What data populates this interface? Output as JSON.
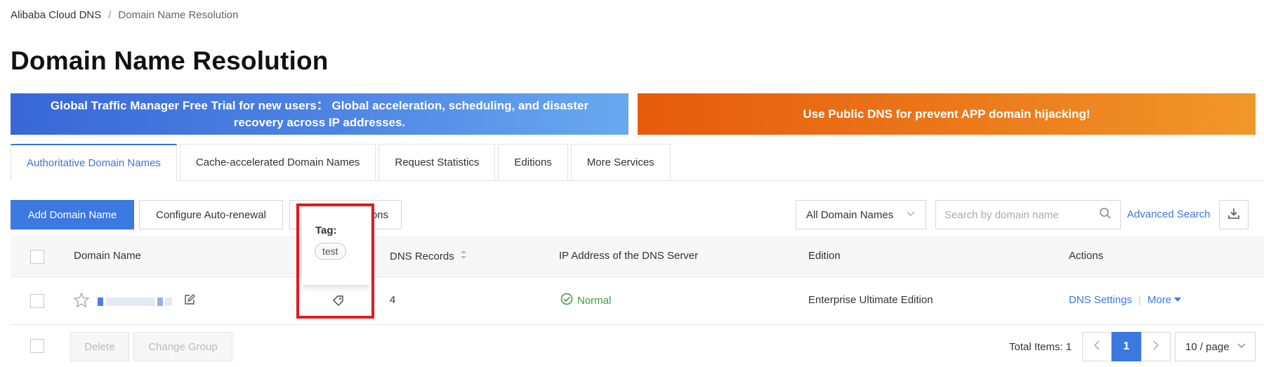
{
  "breadcrumb": {
    "root": "Alibaba Cloud DNS",
    "separator": "/",
    "current": "Domain Name Resolution"
  },
  "page_title": "Domain Name Resolution",
  "banners": {
    "gtm": "Global Traffic Manager Free Trial for new users： Global acceleration, scheduling, and disaster recovery across IP addresses.",
    "public_dns": "Use Public DNS for prevent APP domain hijacking!",
    "gtm_color": "#4f86e4",
    "public_dns_color": "#ec7a1b"
  },
  "tabs": [
    {
      "label": "Authoritative Domain Names",
      "active": true
    },
    {
      "label": "Cache-accelerated Domain Names"
    },
    {
      "label": "Request Statistics"
    },
    {
      "label": "Editions"
    },
    {
      "label": "More Services"
    }
  ],
  "toolbar": {
    "add_domain": "Add Domain Name",
    "auto_renewal": "Configure Auto-renewal",
    "third_button_visible": "ons",
    "domain_filter": "All Domain Names",
    "search_placeholder": "Search by domain name",
    "advanced_search": "Advanced Search",
    "download_icon": "download-icon"
  },
  "table": {
    "columns": {
      "domain": "Domain Name",
      "dns_records": "DNS Records",
      "ip_address": "IP Address of the DNS Server",
      "edition": "Edition",
      "actions": "Actions"
    },
    "rows": [
      {
        "dns_records": "4",
        "status": "Normal",
        "edition": "Enterprise Ultimate Edition",
        "action_settings": "DNS Settings",
        "action_more": "More"
      }
    ]
  },
  "tooltip": {
    "title": "Tag:",
    "tag": "test"
  },
  "footer": {
    "delete": "Delete",
    "change_group": "Change Group",
    "total_items": "Total Items: 1",
    "current_page": "1",
    "page_size": "10 / page"
  },
  "colors": {
    "accent": "#3b78e0",
    "success": "#3a9b3a",
    "highlight": "#e01a22"
  }
}
